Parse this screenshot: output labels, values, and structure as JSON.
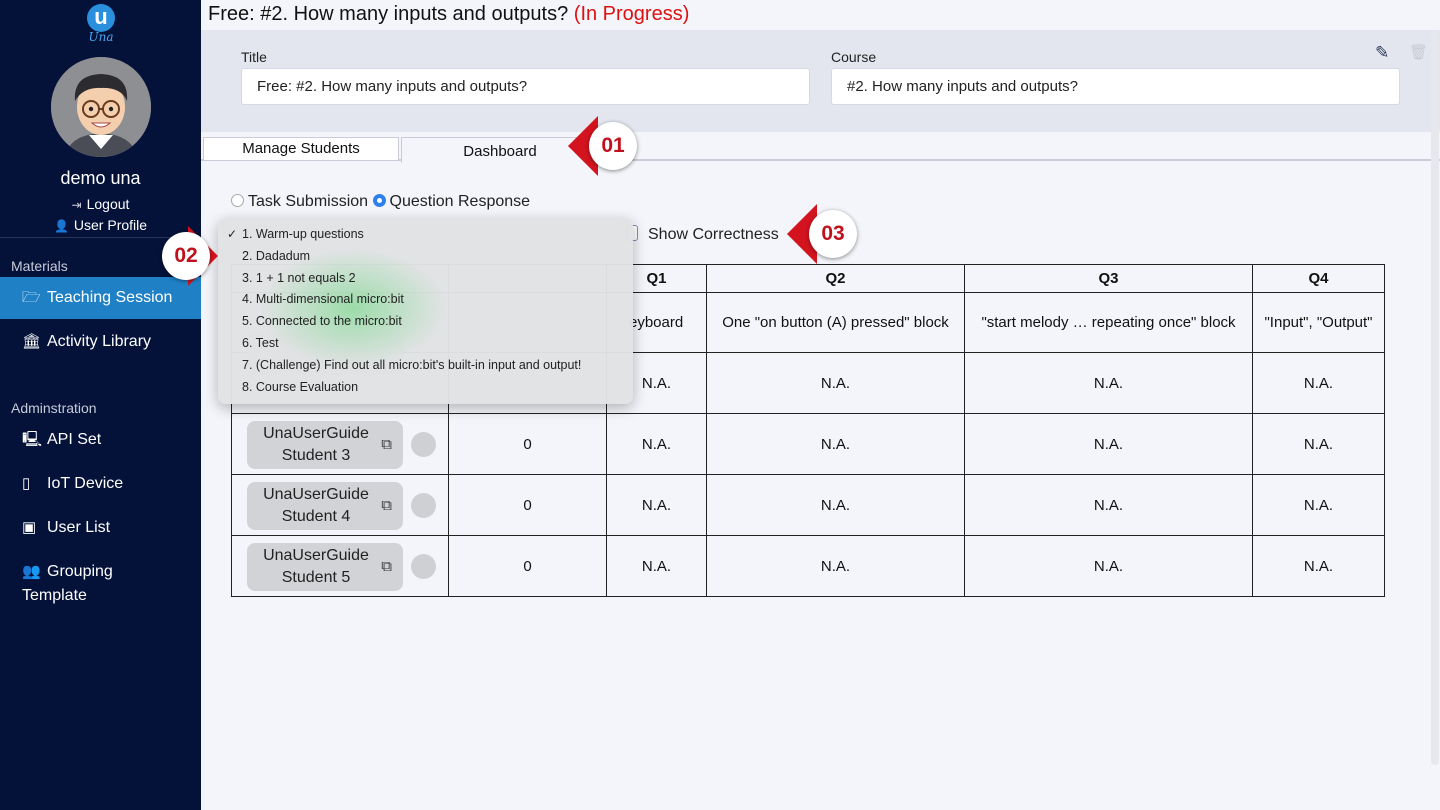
{
  "app": {
    "brand": "Una",
    "logo_letter": "u"
  },
  "sidebar": {
    "username": "demo una",
    "logout": "Logout",
    "profile": "User Profile",
    "materials_label": "Materials",
    "admin_label": "Adminstration",
    "items": [
      {
        "label": "Teaching Session",
        "icon": "folder-open-icon"
      },
      {
        "label": "Activity Library",
        "icon": "bank-icon"
      },
      {
        "label": "API Set",
        "icon": "monitor-icon"
      },
      {
        "label": "IoT Device",
        "icon": "tablet-icon"
      },
      {
        "label": "User List",
        "icon": "contact-card-icon"
      },
      {
        "label": "Grouping Template",
        "icon": "users-icon"
      }
    ]
  },
  "header": {
    "title": "Free: #2. How many inputs and outputs?",
    "status": "(In Progress)"
  },
  "form": {
    "title_label": "Title",
    "title_value": "Free: #2. How many inputs and outputs?",
    "course_label": "Course",
    "course_value": "#2. How many inputs and outputs?"
  },
  "tabs": [
    {
      "label": "Manage Students",
      "active": false
    },
    {
      "label": "Dashboard",
      "active": true
    }
  ],
  "view_mode": {
    "options": [
      "Task Submission",
      "Question Response"
    ],
    "selected": "Question Response"
  },
  "show_correctness": {
    "label": "Show Correctness",
    "checked": false
  },
  "dropdown": {
    "selected": "1. Warm-up questions",
    "items": [
      "1. Warm-up questions",
      "2. Dadadum",
      "3. 1 + 1 not equals 2",
      "4. Multi-dimensional micro:bit",
      "5. Connected to the micro:bit",
      "6. Test",
      "7. (Challenge) Find out all micro:bit's built-in input and output!",
      "8. Course Evaluation"
    ]
  },
  "table": {
    "headers": [
      "Q1",
      "Q2",
      "Q3",
      "Q4"
    ],
    "question_texts": [
      "eyboard",
      "One \"on button (A) pressed\" block",
      "\"start melody … repeating once\" block",
      "\"Input\", \"Output\""
    ],
    "rows": [
      {
        "student": "",
        "score": "",
        "answers": [
          "N.A.",
          "N.A.",
          "N.A.",
          "N.A."
        ]
      },
      {
        "student_line1": "UnaUserGuide",
        "student_line2": "Student 3",
        "score": "0",
        "answers": [
          "N.A.",
          "N.A.",
          "N.A.",
          "N.A."
        ]
      },
      {
        "student_line1": "UnaUserGuide",
        "student_line2": "Student 4",
        "score": "0",
        "answers": [
          "N.A.",
          "N.A.",
          "N.A.",
          "N.A."
        ]
      },
      {
        "student_line1": "UnaUserGuide",
        "student_line2": "Student 5",
        "score": "0",
        "answers": [
          "N.A.",
          "N.A.",
          "N.A.",
          "N.A."
        ]
      }
    ]
  },
  "callouts": [
    "01",
    "02",
    "03"
  ],
  "colors": {
    "sidebar": "#04123a",
    "active_nav": "#1f80c6",
    "status": "#dd1111",
    "callout": "#d3141f"
  }
}
